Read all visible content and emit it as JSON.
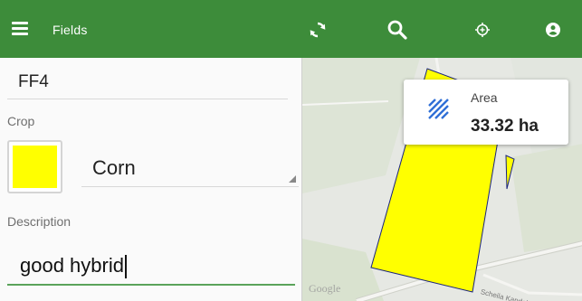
{
  "toolbar": {
    "title": "Fields",
    "actions": [
      "sync-icon",
      "search-icon",
      "add-location-icon",
      "account-icon"
    ]
  },
  "form": {
    "field_name": "FF4",
    "crop_label": "Crop",
    "crop_value": "Corn",
    "crop_color": "#ffff00",
    "description_label": "Description",
    "description_value": "good hybrid"
  },
  "map": {
    "area_label": "Area",
    "area_value": "33.32 ha",
    "attribution": "Google",
    "street_label": "Scheila Kandelstrasse"
  },
  "colors": {
    "toolbar": "#3d8c3a",
    "field_polygon": "#ffff00",
    "active_underline": "#5aa35a",
    "area_icon": "#2f6fd6"
  }
}
